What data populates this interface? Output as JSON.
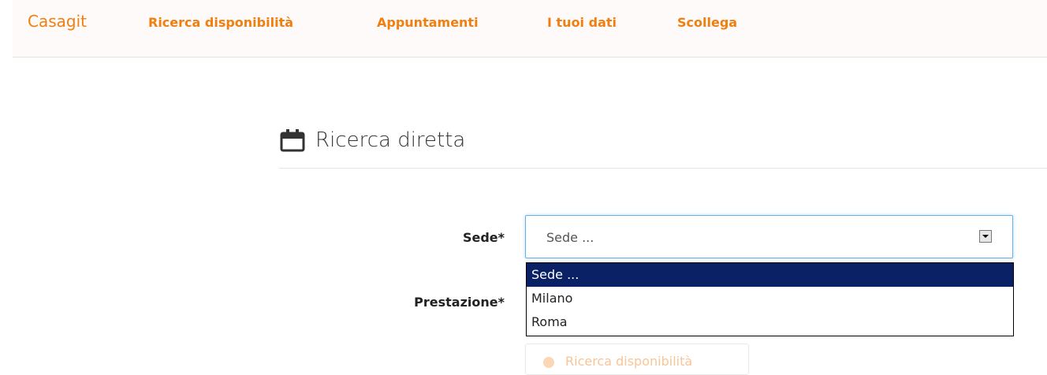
{
  "navbar": {
    "brand": "Casagit",
    "links": [
      "Ricerca disponibilità",
      "Appuntamenti",
      "I tuoi dati",
      "Scollega"
    ]
  },
  "page": {
    "heading": "Ricerca diretta"
  },
  "form": {
    "sede_label": "Sede*",
    "sede_value": "Sede ...",
    "sede_options": [
      "Sede ...",
      "Milano",
      "Roma"
    ],
    "prestazione_label": "Prestazione*",
    "submit_label": "Ricerca disponibilità"
  },
  "colors": {
    "brand": "#f07f10",
    "selected_option": "#0a2166"
  }
}
